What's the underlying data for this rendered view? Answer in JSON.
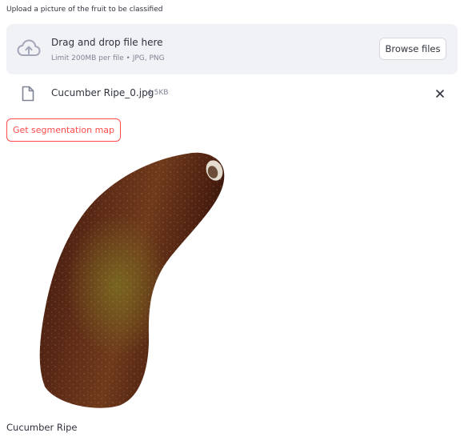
{
  "uploader": {
    "label": "Upload a picture of the fruit to be classified",
    "dropzone_title": "Drag and drop file here",
    "dropzone_limit": "Limit 200MB per file • JPG, PNG",
    "browse_label": "Browse files",
    "cloud_icon": "cloud-upload-icon"
  },
  "file": {
    "name": "Cucumber Ripe_0.jpg",
    "size": "4.5KB",
    "icon": "file-icon",
    "remove_icon": "close-icon"
  },
  "actions": {
    "segmentation_label": "Get segmentation map"
  },
  "result": {
    "caption": "Cucumber Ripe"
  },
  "colors": {
    "accent": "#ff4b4b",
    "dropzone_bg": "#f0f2f6",
    "text": "#31333f",
    "muted": "#808495"
  }
}
